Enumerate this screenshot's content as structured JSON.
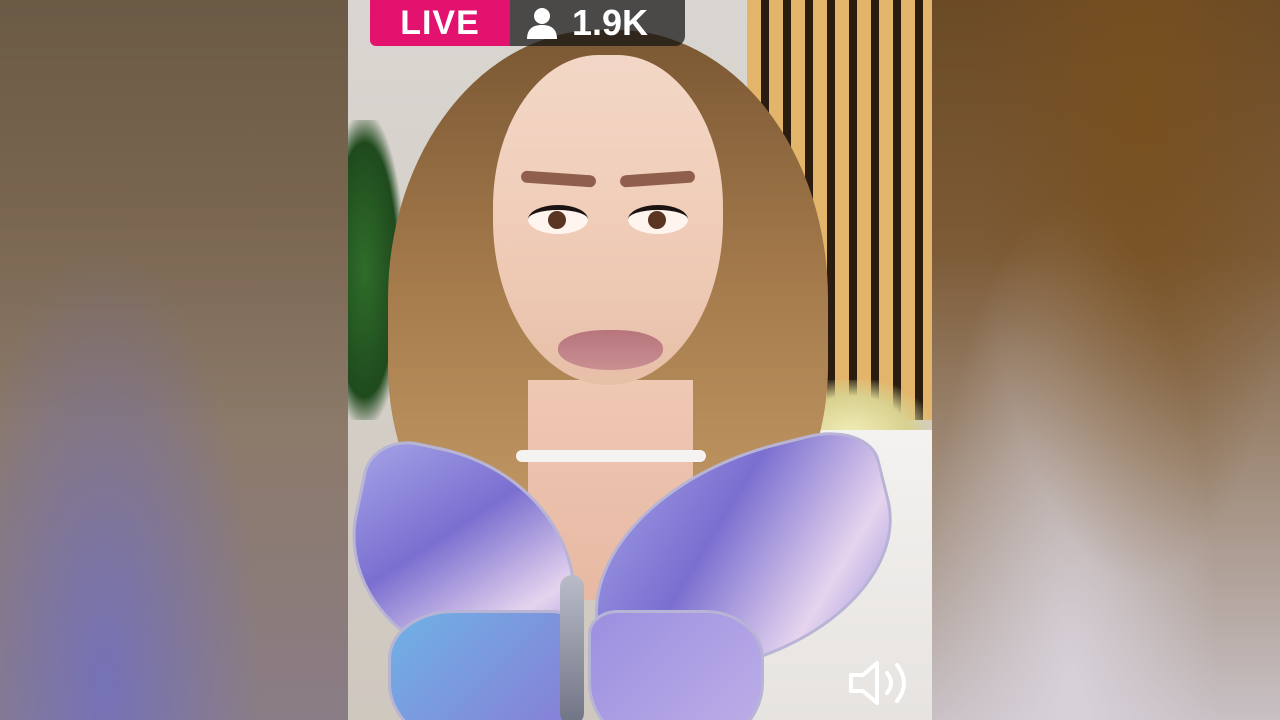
{
  "live_badge": {
    "label": "LIVE",
    "color": "#e3126e"
  },
  "viewers": {
    "count": "1.9K",
    "icon": "person-icon"
  },
  "controls": {
    "sound_icon": "speaker-icon"
  }
}
